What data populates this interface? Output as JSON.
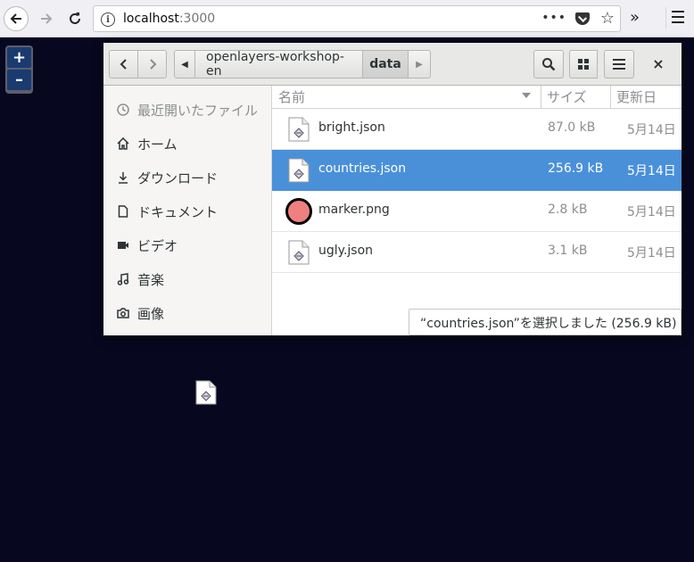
{
  "browser": {
    "url_host": "localhost",
    "url_port": ":3000",
    "more_label": "•••"
  },
  "map": {
    "zoom_in": "+",
    "zoom_out": "–"
  },
  "dialog": {
    "path": [
      "openlayers-workshop-en",
      "data"
    ],
    "close_label": "×",
    "sidebar": [
      {
        "label": "最近開いたファイル",
        "icon": "clock-icon"
      },
      {
        "label": "ホーム",
        "icon": "home-icon"
      },
      {
        "label": "ダウンロード",
        "icon": "download-icon"
      },
      {
        "label": "ドキュメント",
        "icon": "document-icon"
      },
      {
        "label": "ビデオ",
        "icon": "video-icon"
      },
      {
        "label": "音楽",
        "icon": "music-icon"
      },
      {
        "label": "画像",
        "icon": "camera-icon"
      }
    ],
    "columns": {
      "name": "名前",
      "size": "サイズ",
      "modified": "更新日"
    },
    "files": [
      {
        "name": "bright.json",
        "size": "87.0 kB",
        "modified": "5月14日",
        "icon": "json-file-icon"
      },
      {
        "name": "countries.json",
        "size": "256.9 kB",
        "modified": "5月14日",
        "icon": "json-file-icon",
        "selected": true
      },
      {
        "name": "marker.png",
        "size": "2.8 kB",
        "modified": "5月14日",
        "icon": "image-file-icon"
      },
      {
        "name": "ugly.json",
        "size": "3.1 kB",
        "modified": "5月14日",
        "icon": "json-file-icon"
      }
    ],
    "status": "“countries.json”を選択しました (256.9 kB)"
  },
  "colors": {
    "map_background": "#07071f",
    "selection": "#4a90d9",
    "zoom_button": "#1a3b6f",
    "marker_fill": "#f08080"
  }
}
